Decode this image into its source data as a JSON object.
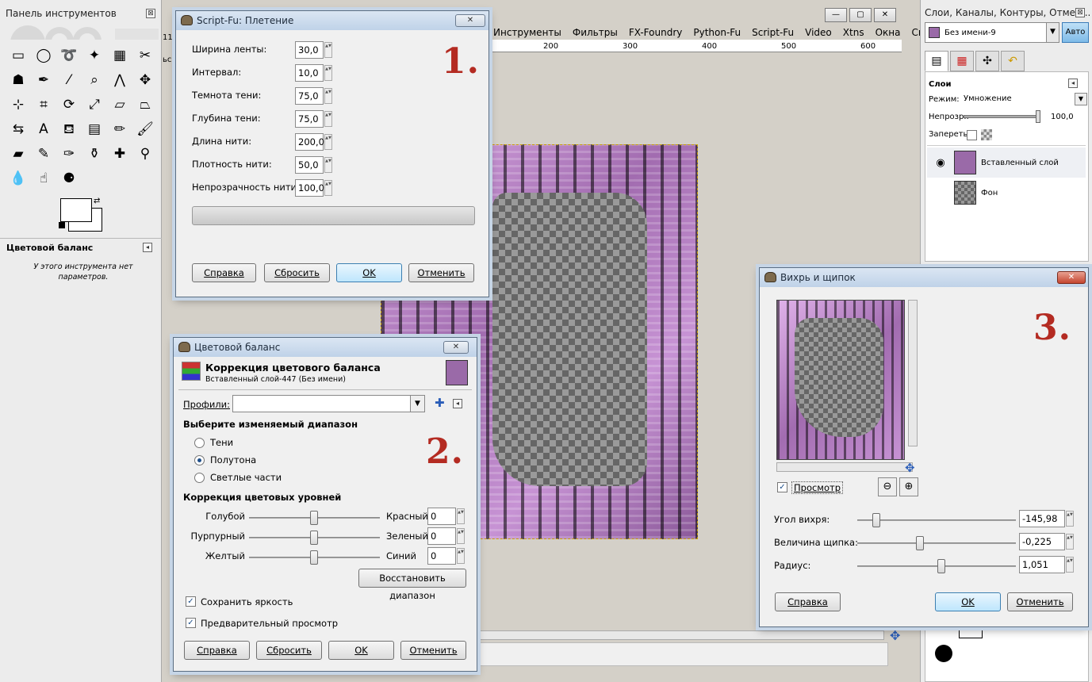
{
  "toolbox": {
    "title": "Панель инструментов",
    "tools": [
      {
        "icon": "rect-select-icon",
        "glyph": "▭"
      },
      {
        "icon": "ellipse-select-icon",
        "glyph": "◯"
      },
      {
        "icon": "lasso-icon",
        "glyph": "➰"
      },
      {
        "icon": "fuzzy-select-icon",
        "glyph": "✦"
      },
      {
        "icon": "color-select-icon",
        "glyph": "▦"
      },
      {
        "icon": "scissors-icon",
        "glyph": "✂"
      },
      {
        "icon": "foreground-select-icon",
        "glyph": "☗"
      },
      {
        "icon": "paths-icon",
        "glyph": "✒"
      },
      {
        "icon": "color-picker-icon",
        "glyph": "⁄"
      },
      {
        "icon": "zoom-icon",
        "glyph": "⌕"
      },
      {
        "icon": "measure-icon",
        "glyph": "⋀"
      },
      {
        "icon": "move-icon",
        "glyph": "✥"
      },
      {
        "icon": "align-icon",
        "glyph": "⊹"
      },
      {
        "icon": "crop-icon",
        "glyph": "⌗"
      },
      {
        "icon": "rotate-icon",
        "glyph": "⟳"
      },
      {
        "icon": "scale-icon",
        "glyph": "⤢"
      },
      {
        "icon": "shear-icon",
        "glyph": "▱"
      },
      {
        "icon": "perspective-icon",
        "glyph": "⏢"
      },
      {
        "icon": "flip-icon",
        "glyph": "⇆"
      },
      {
        "icon": "text-icon",
        "glyph": "A"
      },
      {
        "icon": "bucket-fill-icon",
        "glyph": "⛾"
      },
      {
        "icon": "blend-icon",
        "glyph": "▤"
      },
      {
        "icon": "pencil-icon",
        "glyph": "✏"
      },
      {
        "icon": "paintbrush-icon",
        "glyph": "🖌"
      },
      {
        "icon": "eraser-icon",
        "glyph": "▰"
      },
      {
        "icon": "airbrush-icon",
        "glyph": "✎"
      },
      {
        "icon": "ink-icon",
        "glyph": "✑"
      },
      {
        "icon": "clone-icon",
        "glyph": "⚱"
      },
      {
        "icon": "heal-icon",
        "glyph": "✚"
      },
      {
        "icon": "perspective-clone-icon",
        "glyph": "⚲"
      },
      {
        "icon": "blur-icon",
        "glyph": "💧"
      },
      {
        "icon": "smudge-icon",
        "glyph": "☝"
      },
      {
        "icon": "dodge-burn-icon",
        "glyph": "⚈"
      }
    ],
    "options_title": "Цветовой баланс",
    "options_text": "У этого инструмента нет параметров."
  },
  "image_window": {
    "menu": [
      "Инструменты",
      "Фильтры",
      "FX-Foundry",
      "Python-Fu",
      "Script-Fu",
      "Video",
      "Xtns",
      "Окна",
      "Справка"
    ],
    "ruler_ticks": [
      "200",
      "300",
      "400",
      "500",
      "600"
    ],
    "left_fragments": [
      "11",
      "ьс"
    ],
    "window_controls": [
      "—",
      "▢",
      "✕"
    ]
  },
  "dock": {
    "title": "Слои, Каналы, Контуры, Отмен...",
    "image_name": "Без имени-9",
    "auto_label": "Авто",
    "section": "Слои",
    "mode_label": "Режим:",
    "mode_value": "Умножение",
    "opacity_label": "Непрозр.:",
    "opacity_value": "100,0",
    "lock_label": "Запереть:",
    "layers": [
      {
        "name": "Вставленный слой",
        "visible": true
      },
      {
        "name": "Фон",
        "visible": false
      }
    ]
  },
  "weave_dialog": {
    "title": "Script-Fu: Плетение",
    "number": "1.",
    "fields": [
      {
        "label": "Ширина ленты:",
        "value": "30,0"
      },
      {
        "label": "Интервал:",
        "value": "10,0"
      },
      {
        "label": "Темнота тени:",
        "value": "75,0"
      },
      {
        "label": "Глубина тени:",
        "value": "75,0"
      },
      {
        "label": "Длина нити:",
        "value": "200,0"
      },
      {
        "label": "Плотность нити:",
        "value": "50,0"
      },
      {
        "label": "Непрозрачность нити:",
        "value": "100,0"
      }
    ],
    "buttons": {
      "help": "Справка",
      "reset": "Сбросить",
      "ok": "OK",
      "cancel": "Отменить"
    }
  },
  "color_balance_dialog": {
    "title": "Цветовой баланс",
    "number": "2.",
    "heading": "Коррекция цветового баланса",
    "subheading": "Вставленный слой-447 (Без имени)",
    "profiles_label": "Профили:",
    "range_heading": "Выберите изменяемый диапазон",
    "ranges": [
      "Тени",
      "Полутона",
      "Светлые части"
    ],
    "selected_range": "Полутона",
    "levels_heading": "Коррекция цветовых уровней",
    "levels": [
      {
        "left": "Голубой",
        "right": "Красный",
        "value": "0"
      },
      {
        "left": "Пурпурный",
        "right": "Зеленый",
        "value": "0"
      },
      {
        "left": "Желтый",
        "right": "Синий",
        "value": "0"
      }
    ],
    "reset_range": "Восстановить диапазон",
    "preserve": "Сохранить яркость",
    "preview": "Предварительный просмотр",
    "buttons": {
      "help": "Справка",
      "reset": "Сбросить",
      "ok": "OK",
      "cancel": "Отменить"
    }
  },
  "whirl_dialog": {
    "title": "Вихрь и щипок",
    "number": "3.",
    "preview_label": "Просмотр",
    "params": [
      {
        "label": "Угол вихря:",
        "value": "-145,98",
        "pos": 0.1
      },
      {
        "label": "Величина щипка:",
        "value": "-0,225",
        "pos": 0.39
      },
      {
        "label": "Радиус:",
        "value": "1,051",
        "pos": 0.53
      }
    ],
    "buttons": {
      "help": "Справка",
      "ok": "OK",
      "cancel": "Отменить"
    }
  }
}
